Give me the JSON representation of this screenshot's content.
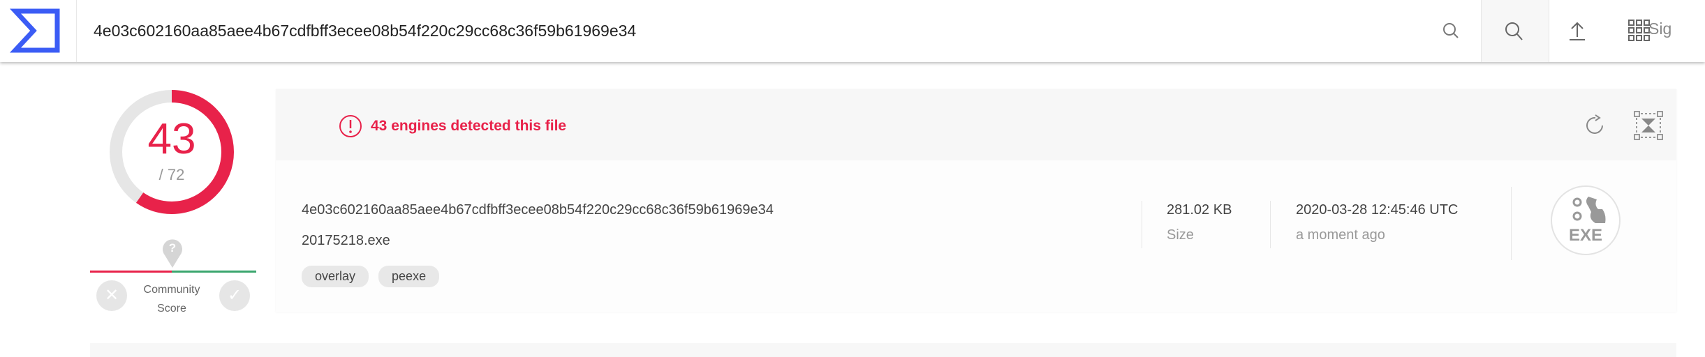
{
  "header": {
    "search_value": "4e03c602160aa85aee4b67cdfbff3ecee08b54f220c29cc68c36f59b61969e34",
    "signin_label": "Sig",
    "icons": [
      "virustotal-logo",
      "search-icon",
      "search-icon",
      "upload-icon",
      "grid-icon"
    ],
    "accent": "#3b5cf5"
  },
  "score": {
    "detections": "43",
    "total": "/ 72",
    "fraction": 0.597,
    "color": "#e8224a"
  },
  "community": {
    "label_line1": "Community",
    "label_line2": "Score",
    "pin": "?"
  },
  "summary": {
    "alert": "43 engines detected this file",
    "hash": "4e03c602160aa85aee4b67cdfbff3ecee08b54f220c29cc68c36f59b61969e34",
    "filename": "20175218.exe",
    "tags": [
      "overlay",
      "peexe"
    ],
    "size_value": "281.02 KB",
    "size_label": "Size",
    "date_value": "2020-03-28 12:45:46 UTC",
    "date_label": "a moment ago",
    "filetype": "EXE"
  }
}
